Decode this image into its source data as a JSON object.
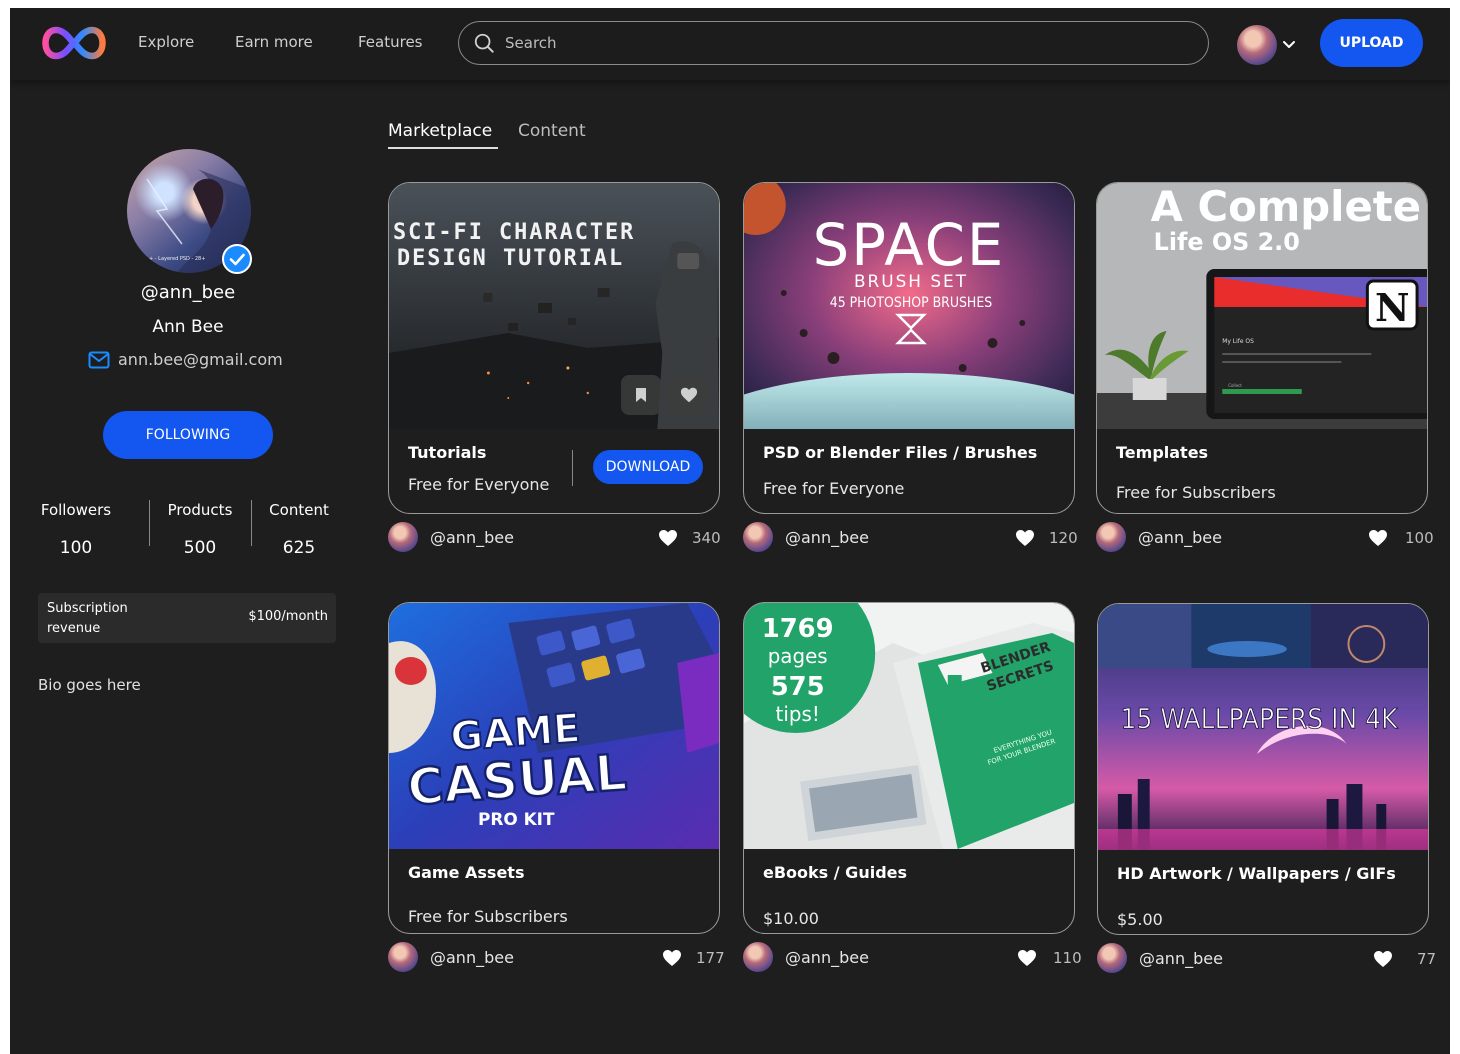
{
  "nav": {
    "links": [
      "Explore",
      "Earn more",
      "Features"
    ],
    "search_placeholder": "Search",
    "upload_label": "UPLOAD"
  },
  "profile": {
    "username": "@ann_bee",
    "name": "Ann Bee",
    "email": "ann.bee@gmail.com",
    "avatar_caption": "+ - Layered PSD - 28+",
    "follow_label": "FOLLOWING",
    "stats": [
      {
        "label": "Followers",
        "value": "100"
      },
      {
        "label": "Products",
        "value": "500"
      },
      {
        "label": "Content",
        "value": "625"
      }
    ],
    "subscription_label": "Subscription revenue",
    "subscription_value": "$100/month",
    "bio": "Bio goes here"
  },
  "tabs": [
    "Marketplace",
    "Content"
  ],
  "cards": [
    {
      "category": "Tutorials",
      "price": "Free for Everyone",
      "user": "@ann_bee",
      "likes": "340",
      "download_label": "DOWNLOAD",
      "art": {
        "line1": "SCI-FI CHARACTER",
        "line2": "DESIGN TUTORIAL"
      }
    },
    {
      "category": "PSD or Blender Files / Brushes",
      "price": "Free for Everyone",
      "user": "@ann_bee",
      "likes": "120",
      "art": {
        "title": "SPACE",
        "sub1": "BRUSH SET",
        "sub2": "45 PHOTOSHOP BRUSHES"
      }
    },
    {
      "category": "Templates",
      "price": "Free for Subscribers",
      "user": "@ann_bee",
      "likes": "100",
      "art": {
        "title": "A Complete",
        "sub": "Life OS 2.0",
        "badge": "N",
        "app": "My Life OS",
        "item": "Collect"
      }
    },
    {
      "category": "Game Assets",
      "price": "Free for Subscribers",
      "user": "@ann_bee",
      "likes": "177",
      "art": {
        "line1": "GAME",
        "line2": "CASUAL",
        "line3": "PRO KIT"
      }
    },
    {
      "category": "eBooks / Guides",
      "price": "$10.00",
      "user": "@ann_bee",
      "likes": "110",
      "art": {
        "n1": "1769",
        "w1": "pages",
        "n2": "575",
        "w2": "tips!",
        "book1": "BLENDER",
        "book2": "SECRETS",
        "tag1": "EVERYTHING YOU",
        "tag2": "FOR YOUR BLENDER"
      }
    },
    {
      "category": "HD Artwork / Wallpapers / GIFs",
      "price": "$5.00",
      "user": "@ann_bee",
      "likes": "77",
      "art": {
        "title": "15 WALLPAPERS IN 4K"
      }
    }
  ],
  "colors": {
    "accent": "#1356f0",
    "background": "#1e1e1e",
    "header": "#1c1c1c"
  },
  "icons": [
    "logo-infinity",
    "search-icon",
    "chevron-down-icon",
    "verified-icon",
    "mail-icon",
    "bookmark-icon",
    "heart-icon"
  ]
}
